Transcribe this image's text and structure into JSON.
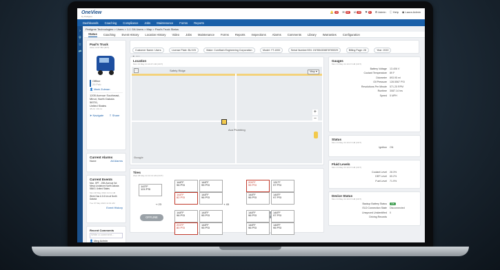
{
  "app": {
    "logo_text": "OneView",
    "logo_sub": "by Pedigree"
  },
  "topbar": {
    "badges": [
      "11",
      "99",
      "99",
      "9"
    ],
    "admin_label": "Admin",
    "help_label": "Help",
    "user_label": "Laura Admin"
  },
  "nav": [
    "Dashboards",
    "Coaching",
    "Compliance",
    "Jobs",
    "Maintenance",
    "Forms",
    "Reports"
  ],
  "breadcrumb": "Pedigree Technologies  >  Users  >  1-1 GA Users  >  Map  >  Paul's Truck   Status",
  "tabs": [
    "Status",
    "Coaching",
    "Event History",
    "Location History",
    "Video",
    "Jobs",
    "Maintenance",
    "Forms",
    "Reports",
    "Inspections",
    "Alarms",
    "Comments",
    "Library",
    "Warranties",
    "Configuration"
  ],
  "asset": {
    "name": "Paul's Truck",
    "sub": "Ultra 13 0T 8M (2DT)",
    "status_offline": "Offline",
    "status_time": "29 Feb",
    "driver": "Mark Zulman",
    "address": [
      "1205 Avenue Southeast,",
      "Minot, North Dakota 58701,",
      "United States"
    ],
    "coords": "48.22, 101.11",
    "navigate": "Navigate",
    "share": "Share"
  },
  "pills": [
    "Customer Name: Users",
    "License Plate: BU 8 B",
    "Make: Cornflash Engineering Corporation",
    "Model: YT-1000",
    "Serial Number/VIN: 1N7654328878765329",
    "Billing Page: 28",
    "Year: 2022"
  ],
  "pill_sub": "331",
  "location": {
    "title": "Location",
    "sub": "Mon 13 May 24 10:47 AM (CDT)",
    "map_btn": "Map",
    "map_label1": "Aca Plumbing",
    "map_label2": "Safety Ridge",
    "brand": "Google"
  },
  "tires": {
    "title": "Tires",
    "sub": "Wed 08 May 24 10:13 AM (CDT)",
    "left_truck": {
      "front": [
        "143°F",
        "124 PSI"
      ],
      "axle": "23",
      "offline": "OFFLINE"
    },
    "group1": [
      [
        "148°F",
        "96 PSI",
        false
      ],
      [
        "148°F",
        "95 PSI",
        false
      ],
      [
        "148°F",
        "82 PSI",
        true
      ],
      [
        "148°F",
        "96 PSI",
        false
      ],
      [
        "148°F",
        "96 PSI",
        false
      ],
      [
        "148°F",
        "95 PSI",
        false
      ],
      [
        "203°F",
        "80 PSI",
        true
      ],
      [
        "148°F",
        "95 PSI",
        false
      ]
    ],
    "mid_axle": "45",
    "group2": [
      [
        "205°F",
        "95 PSI",
        true
      ],
      [
        "131°F",
        "97 PSI",
        false
      ],
      [
        "148°F",
        "96 PSI",
        false
      ],
      [
        "148°F",
        "97 PSI",
        false
      ],
      [
        "148°F",
        "96 PSI",
        false
      ],
      [
        "148°F",
        "97 PSI",
        false
      ],
      [
        "148°F",
        "96 PSI",
        false
      ],
      [
        "148°F",
        "95 PSI",
        false
      ]
    ],
    "offline2": "OFFLINE"
  },
  "alarms": {
    "title": "Current Alarms",
    "none": "None",
    "link": "All Alarms"
  },
  "events": {
    "title": "Current Events",
    "items": [
      "Mon, 5PT - 19th Avenue 0ct Mesa Lindstrom North Dakota 58401 United States",
      "Mon 08 May 2024 11:41 AM",
      "Went Gas & 6.6 km at North Dakota",
      "Tue 07 May 2024 11:01 AM"
    ],
    "link": "Event History"
  },
  "comments": {
    "title": "Recent Comments",
    "placeholder": "Write a comment...",
    "author": "Meg Admin"
  },
  "gauges": {
    "title": "Gauges",
    "sub": "Mon 13 May 24 10:47 AM (CDT)",
    "rows": [
      [
        "Battery Voltage",
        "13.406 V"
      ],
      [
        "Coolant Temperature",
        "89 F"
      ],
      [
        "Odometer",
        "893.95 mi"
      ],
      [
        "Oil Pressure",
        "128.5567 PSI"
      ],
      [
        "Revolutions Per Minute",
        "571.25 RPM"
      ],
      [
        "Runtime",
        "3087.14 hrs"
      ],
      [
        "Speed",
        "5 MPH"
      ]
    ]
  },
  "status_card": {
    "title": "Status",
    "sub": "Mon 13 May 24 10:47 AM (CDT)",
    "ignition_label": "Ignition",
    "ignition_val": "ON"
  },
  "fluids": {
    "title": "Fluid Levels",
    "sub": "Mon 13 May 24 10:47 AM (CDT)",
    "rows": [
      [
        "Coolant Level",
        "28.3%"
      ],
      [
        "DEF Level",
        "65.2%"
      ],
      [
        "Fuel Level",
        "71.9%"
      ]
    ]
  },
  "device": {
    "title": "Device Status",
    "sub": "Mon 13 May 24 10:47 AM (CDT)",
    "rows": [
      [
        "Backup Battery Status",
        "OK"
      ],
      [
        "ELD Connection State",
        "Disconnected"
      ],
      [
        "Unsynced Unidentified",
        "0"
      ],
      [
        "Driving Records",
        ""
      ]
    ]
  },
  "colors": {
    "nav": "#1a5fa8",
    "alert": "#c0392b",
    "ok": "#3a9b4c"
  }
}
